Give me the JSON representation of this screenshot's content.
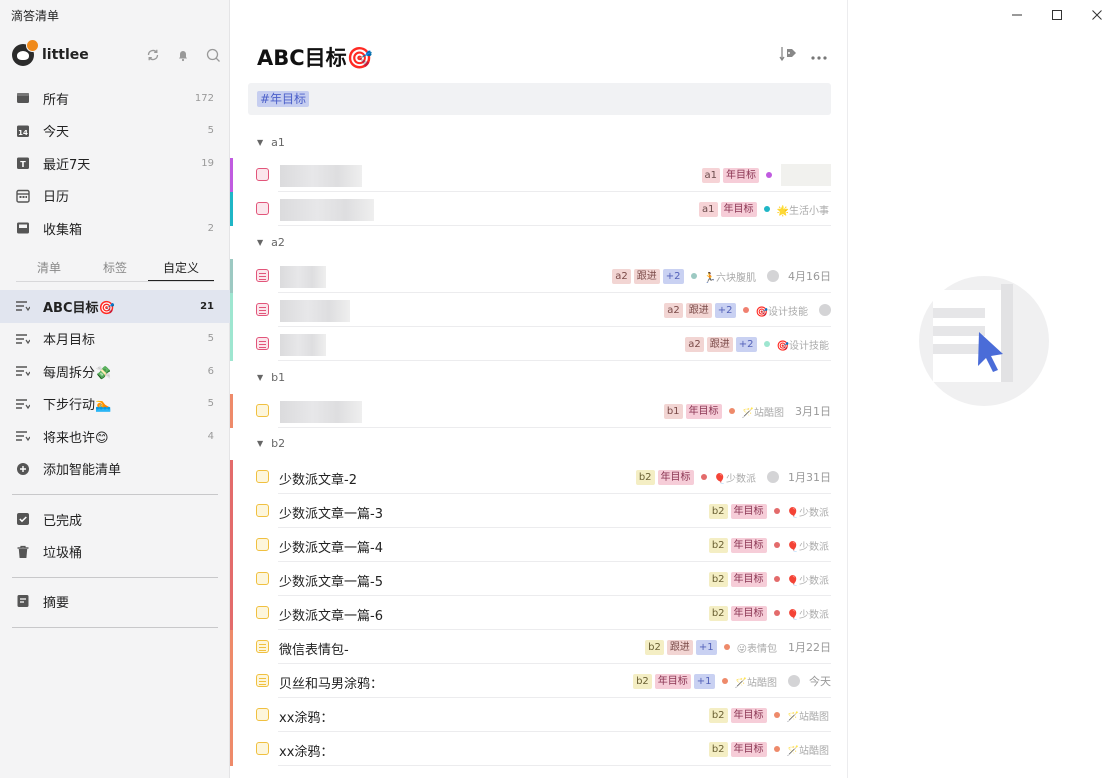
{
  "app": {
    "title": "滴答清单"
  },
  "user": {
    "name": "littlee"
  },
  "nav": [
    {
      "label": "所有",
      "count": "172",
      "icon": "inbox-all-icon"
    },
    {
      "label": "今天",
      "count": "5",
      "icon": "calendar-14-icon"
    },
    {
      "label": "最近7天",
      "count": "19",
      "icon": "calendar-7-icon"
    },
    {
      "label": "日历",
      "count": "",
      "icon": "calendar-grid-icon"
    },
    {
      "label": "收集箱",
      "count": "2",
      "icon": "inbox-tray-icon"
    }
  ],
  "tabs": [
    "清单",
    "标签",
    "自定义"
  ],
  "custom": [
    {
      "label": "ABC目标🎯",
      "count": "21",
      "active": true
    },
    {
      "label": "本月目标",
      "count": "5"
    },
    {
      "label": "每周拆分💸",
      "count": "6"
    },
    {
      "label": "下步行动🏊",
      "count": "5"
    },
    {
      "label": "将来也许😊",
      "count": "4"
    }
  ],
  "add_smart": {
    "label": "添加智能清单"
  },
  "bottom_nav": [
    {
      "label": "已完成"
    },
    {
      "label": "垃圾桶"
    }
  ],
  "summary": {
    "label": "摘要"
  },
  "main": {
    "title": "ABC目标🎯",
    "filter_tag": "#年目标"
  },
  "groups": [
    {
      "name": "a1"
    },
    {
      "name": "a2"
    },
    {
      "name": "b1"
    },
    {
      "name": "b2"
    }
  ],
  "tasks": [
    {
      "title": "",
      "tags": [
        [
          "a1",
          "plain"
        ],
        [
          "年目标",
          "goal"
        ]
      ],
      "dot": "#c05be0",
      "project": "",
      "date": "",
      "blurbox": true
    },
    {
      "title": "",
      "tags": [
        [
          "a1",
          "plain"
        ],
        [
          "年目标",
          "goal"
        ]
      ],
      "dot": "#1fb6c6",
      "project": "🌟生活小事",
      "date": ""
    },
    {
      "title": "",
      "tags": [
        [
          "a2",
          "follow"
        ],
        [
          "跟进",
          "follow"
        ],
        [
          "+2",
          "plus"
        ]
      ],
      "dot": "#9cc9c2",
      "project": "🏃六块腹肌",
      "date": "4月16日"
    },
    {
      "title": "",
      "tags": [
        [
          "a2",
          "follow"
        ],
        [
          "跟进",
          "follow"
        ],
        [
          "+2",
          "plus"
        ]
      ],
      "dot": "#f08070",
      "project": "🎯设计技能",
      "date": ""
    },
    {
      "title": "",
      "tags": [
        [
          "a2",
          "follow"
        ],
        [
          "跟进",
          "follow"
        ],
        [
          "+2",
          "plus"
        ]
      ],
      "dot": "#9ee6d0",
      "project": "🎯设计技能",
      "date": ""
    },
    {
      "title": "",
      "tags": [
        [
          "b1",
          "follow"
        ],
        [
          "年目标",
          "goal"
        ]
      ],
      "dot": "#ee8a6a",
      "project": "🪄站酷图",
      "date": "3月1日"
    },
    {
      "title": "少数派文章-2",
      "tags": [
        [
          "b2",
          "b"
        ],
        [
          "年目标",
          "goal"
        ]
      ],
      "dot": "#e36b6b",
      "project": "🎈少数派",
      "date": "1月31日"
    },
    {
      "title": "少数派文章一篇-3",
      "tags": [
        [
          "b2",
          "b"
        ],
        [
          "年目标",
          "goal"
        ]
      ],
      "dot": "#e36b6b",
      "project": "🎈少数派",
      "date": ""
    },
    {
      "title": "少数派文章一篇-4",
      "tags": [
        [
          "b2",
          "b"
        ],
        [
          "年目标",
          "goal"
        ]
      ],
      "dot": "#e36b6b",
      "project": "🎈少数派",
      "date": ""
    },
    {
      "title": "少数派文章一篇-5",
      "tags": [
        [
          "b2",
          "b"
        ],
        [
          "年目标",
          "goal"
        ]
      ],
      "dot": "#e36b6b",
      "project": "🎈少数派",
      "date": ""
    },
    {
      "title": "少数派文章一篇-6",
      "tags": [
        [
          "b2",
          "b"
        ],
        [
          "年目标",
          "goal"
        ]
      ],
      "dot": "#e36b6b",
      "project": "🎈少数派",
      "date": ""
    },
    {
      "title": "微信表情包-",
      "tags": [
        [
          "b2",
          "b"
        ],
        [
          "跟进",
          "follow"
        ],
        [
          "+1",
          "plus"
        ]
      ],
      "dot": "#ee8a6a",
      "project": "😜表情包",
      "date": "1月22日"
    },
    {
      "title": "贝丝和马男涂鸦：",
      "tags": [
        [
          "b2",
          "b"
        ],
        [
          "年目标",
          "goal"
        ],
        [
          "+1",
          "plus"
        ]
      ],
      "dot": "#ee8a6a",
      "project": "🪄站酷图",
      "date": "今天"
    },
    {
      "title": "xx涂鸦：",
      "tags": [
        [
          "b2",
          "b"
        ],
        [
          "年目标",
          "goal"
        ]
      ],
      "dot": "#ee8a6a",
      "project": "🪄站酷图",
      "date": ""
    },
    {
      "title": "xx涂鸦：",
      "tags": [
        [
          "b2",
          "b"
        ],
        [
          "年目标",
          "goal"
        ]
      ],
      "dot": "#ee8a6a",
      "project": "🪄站酷图",
      "date": ""
    }
  ],
  "colors": {
    "accent": "#4b5fc9",
    "stripe_a1": "#c05be0",
    "stripe_a2": "#9ee6d0",
    "stripe_b1": "#ee8a6a",
    "stripe_b2": "#e36b6b",
    "check_a": "#e2557a",
    "check_b": "#f0c040"
  }
}
